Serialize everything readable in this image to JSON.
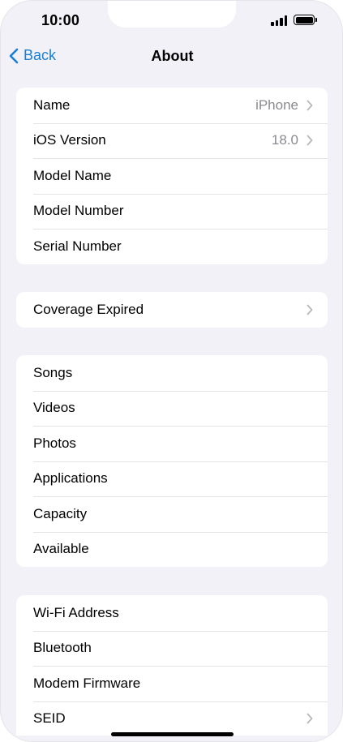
{
  "status": {
    "time": "10:00"
  },
  "nav": {
    "back_label": "Back",
    "title": "About"
  },
  "group1": [
    {
      "label": "Name",
      "value": "iPhone",
      "chevron": true
    },
    {
      "label": "iOS Version",
      "value": "18.0",
      "chevron": true
    },
    {
      "label": "Model Name",
      "value": "",
      "chevron": false
    },
    {
      "label": "Model Number",
      "value": "",
      "chevron": false
    },
    {
      "label": "Serial Number",
      "value": "",
      "chevron": false
    }
  ],
  "group2": [
    {
      "label": "Coverage Expired",
      "value": "",
      "chevron": true
    }
  ],
  "group3": [
    {
      "label": "Songs"
    },
    {
      "label": "Videos"
    },
    {
      "label": "Photos"
    },
    {
      "label": "Applications"
    },
    {
      "label": "Capacity"
    },
    {
      "label": "Available"
    }
  ],
  "group4": [
    {
      "label": "Wi-Fi Address",
      "chevron": false
    },
    {
      "label": "Bluetooth",
      "chevron": false
    },
    {
      "label": "Modem Firmware",
      "chevron": false
    },
    {
      "label": "SEID",
      "chevron": true
    }
  ],
  "colors": {
    "accent": "#1a7ed3",
    "background": "#f2f1f7",
    "secondary_text": "#8a8a8f",
    "separator": "#e3e3e8"
  }
}
